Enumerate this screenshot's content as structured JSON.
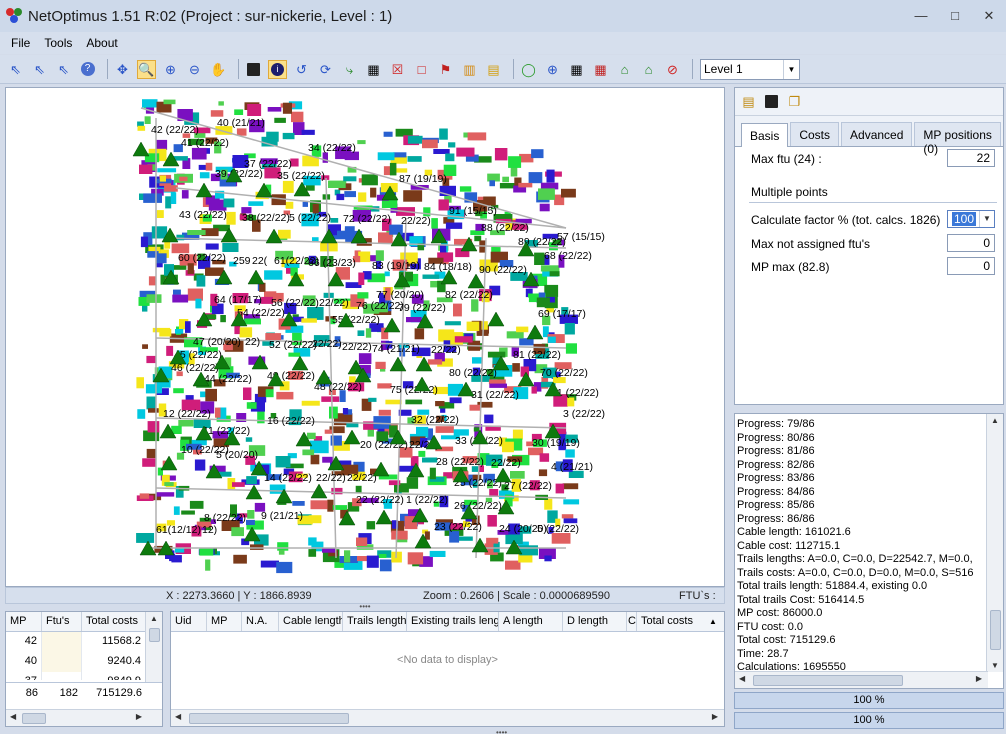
{
  "window": {
    "title": "NetOptimus 1.51 R:02 (Project : sur-nickerie, Level : 1)",
    "minimize": "—",
    "restore": "□",
    "close": "✕"
  },
  "menu": [
    "File",
    "Tools",
    "About"
  ],
  "toolbar": {
    "level_value": "Level 1",
    "icons": [
      "select-arrow-icon",
      "select-add-icon",
      "select-remove-icon",
      "help-icon",
      "pan-center-icon",
      "zoom-window-icon",
      "zoom-in-icon",
      "zoom-out-icon",
      "pan-hand-icon",
      "save-icon",
      "info-icon",
      "undo-curve-icon",
      "refresh-icon",
      "route-icon",
      "building-icon",
      "delete-red-box-icon",
      "rectangle-icon",
      "chart-bar-icon",
      "chart-columns-icon",
      "report-icon",
      "node-green-icon",
      "add-node-icon",
      "calculator-icon",
      "calc-red-icon",
      "house-green-icon",
      "house-outline-icon",
      "no-entry-icon"
    ]
  },
  "map": {
    "labels": [
      "40 (21/21)",
      "42 (22/22)",
      "41 (22/22)",
      "34 (22/22)",
      "37 (22/22)",
      "39 (22/22)",
      "35 (22/22)",
      "87 (19/19)",
      "43 (22/22)",
      "38 (22/22)",
      "5 (22/22)",
      "72 (22/22)",
      "22/22)",
      "91 (15/15)",
      "88 (22/22)",
      "57 (15/15)",
      "89 (22/22)",
      "60 (22/22)",
      "259",
      "22(",
      "61(22/22)",
      "66 (23/23)",
      "83 (19/19)",
      "84 (18/18)",
      "90 (22/22)",
      "68 (22/22)",
      "64 (17/17)",
      "56 (22/22)",
      "22/22)",
      "76 (22/22)",
      "77 (20/20)",
      "82 (22/22)",
      "79 (22/22)",
      "54 (22/22)",
      "55 (22/22)",
      "69 (17/17)",
      "47 (20/20)",
      "22)",
      "52 (22/22)",
      "22/22)",
      "22/22)",
      "74 (21/21)",
      "22/22)",
      "81 (22/22)",
      "45 (22/22)",
      "46 (22/22)",
      "44 (22/22)",
      "49 (22/22)",
      "48 (22/22)",
      "75 (22/22)",
      "80 (22/22)",
      "70 (22/22)",
      "71 (22/22)",
      "31 (22/22)",
      "12 (22/22)",
      "16 (22/22)",
      "32 (22/22)",
      "3 (22/22)",
      "11 (22/22)",
      "33 (22/22)",
      "30 (19/19)",
      "10 (22/22)",
      "5 (20/20)",
      "20 (22/22)",
      "22/22)",
      "28 (22/22)",
      "22/22)",
      "4 (21/21)",
      "14 (22/22)",
      "22/22)",
      "22/22)",
      "25 (22/22)",
      "27 (22/22)",
      "22 (22/22)",
      "1 (22/22)",
      "26 (22/22)",
      "8 (22/22)",
      "9 (21/21)",
      "23 (22/22)",
      "24 (20/20)",
      "5 (22/22)",
      "61(12/12)",
      "12)"
    ]
  },
  "status": {
    "coords": "X : 2273.3660 | Y : 1866.8939",
    "zoom": "Zoom : 0.2606 | Scale : 0.0000689590",
    "ftus": "FTU`s :"
  },
  "mp_table": {
    "headers": [
      "MP",
      "Ftu's",
      "Total costs"
    ],
    "rows": [
      [
        "42",
        "",
        "11568.2"
      ],
      [
        "40",
        "",
        "9240.4"
      ],
      [
        "37",
        "",
        "9849.9"
      ]
    ],
    "footer": [
      "86",
      "182",
      "715129.6"
    ]
  },
  "detail_table": {
    "headers": [
      "Uid",
      "MP",
      "N.A.",
      "Cable length",
      "Trails length",
      "Existing trails leng",
      "A length",
      "D length",
      "C",
      "Total costs"
    ],
    "empty": "<No data to display>"
  },
  "settings": {
    "tabs": [
      "Basis",
      "Costs",
      "Advanced",
      "MP positions (0)"
    ],
    "max_ftu_label": "Max ftu (24) :",
    "max_ftu_value": "22",
    "multiple_points": "Multiple points",
    "calc_factor_label": "Calculate factor % (tot. calcs. 1826)",
    "calc_factor_value": "100",
    "max_not_assigned_label": "Max not assigned ftu's",
    "max_not_assigned_value": "0",
    "mp_max_label": "MP max (82.8)",
    "mp_max_value": "0"
  },
  "log": [
    "Progress: 79/86",
    "Progress: 80/86",
    "Progress: 81/86",
    "Progress: 82/86",
    "Progress: 83/86",
    "Progress: 84/86",
    "Progress: 85/86",
    "Progress: 86/86",
    "Cable length: 161021.6",
    "Cable cost: 112715.1",
    "Trails lengths: A=0.0, C=0.0, D=22542.7, M=0.0,",
    "Trails costs: A=0.0, C=0.0, D=0.0, M=0.0, S=516",
    "Total trails length: 51884.4, existing 0.0",
    "Total trails Cost: 516414.5",
    "MP cost: 86000.0",
    "FTU cost: 0.0",
    "Total cost: 715129.6",
    "Time: 28.7",
    "Calculations: 1695550"
  ],
  "progress": [
    "100 %",
    "100 %"
  ]
}
